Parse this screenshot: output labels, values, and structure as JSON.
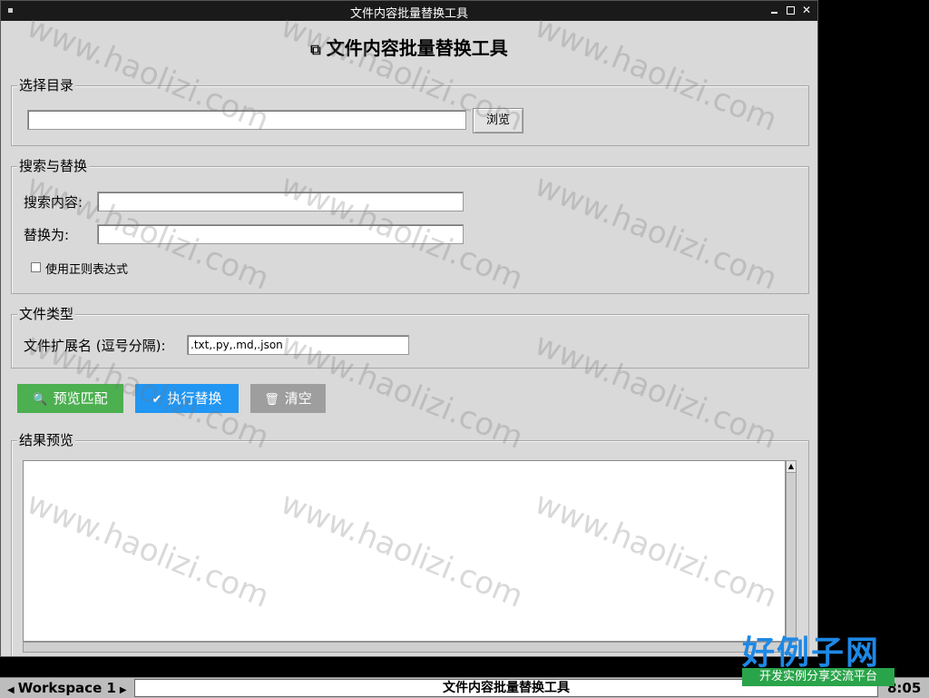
{
  "window": {
    "title": "文件内容批量替换工具"
  },
  "app": {
    "heading_icon": "⧉",
    "heading": "文件内容批量替换工具"
  },
  "dir_group": {
    "label": "选择目录",
    "path_value": "",
    "browse_label": "浏览"
  },
  "search_group": {
    "label": "搜索与替换",
    "search_label": "搜索内容:",
    "search_value": "",
    "replace_label": "替换为:",
    "replace_value": "",
    "regex_label": "使用正则表达式",
    "regex_checked": false
  },
  "type_group": {
    "label": "文件类型",
    "ext_label": "文件扩展名 (逗号分隔):",
    "ext_value": ".txt,.py,.md,.json"
  },
  "actions": {
    "preview": {
      "icon": "search-icon",
      "label": "预览匹配",
      "color": "#4caf50"
    },
    "execute": {
      "icon": "check-icon",
      "label": "执行替换",
      "color": "#2196f3"
    },
    "clear": {
      "icon": "trash-icon",
      "label": "清空",
      "color": "#9e9e9e"
    }
  },
  "results": {
    "label": "结果预览",
    "content": ""
  },
  "watermark": "www.haolizi.com",
  "logo": {
    "main": "好例子网",
    "sub": "开发实例分享交流平台"
  },
  "taskbar": {
    "workspace": "Workspace 1",
    "task_title": "文件内容批量替换工具",
    "clock": "8:05"
  }
}
